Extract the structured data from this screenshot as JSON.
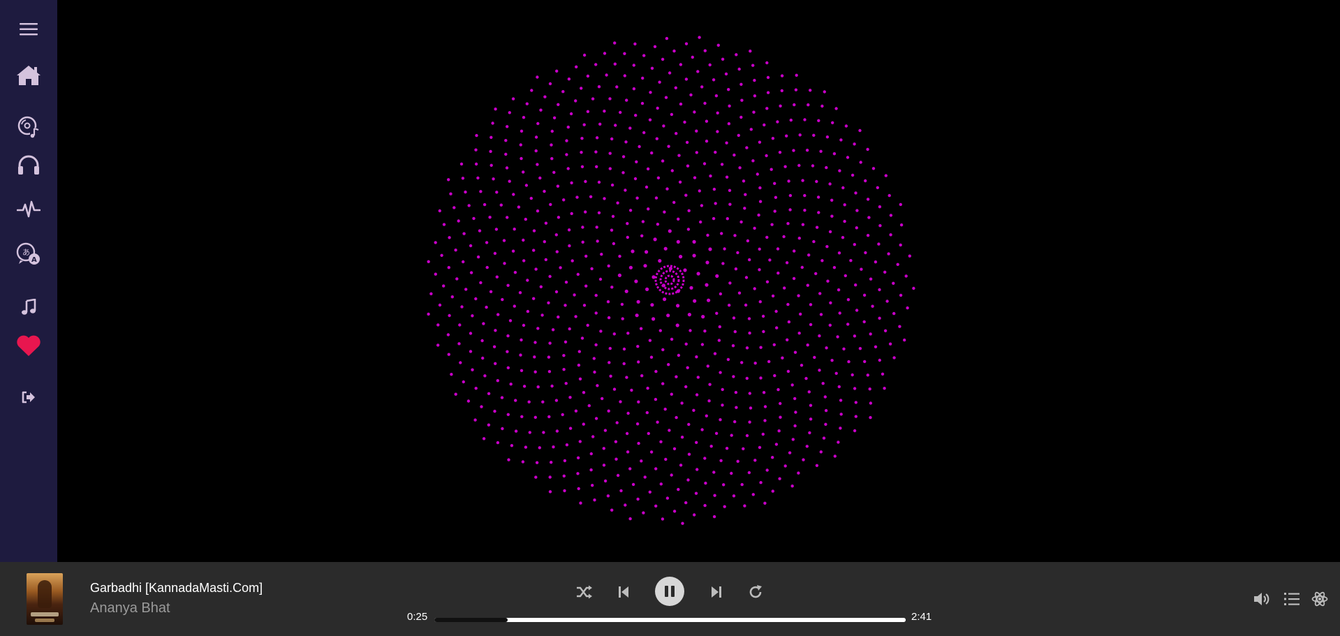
{
  "sidebar": {
    "items": [
      {
        "icon": "hamburger-menu-icon"
      },
      {
        "icon": "home-icon"
      },
      {
        "icon": "disc-music-icon"
      },
      {
        "icon": "headphones-icon"
      },
      {
        "icon": "pulse-icon"
      },
      {
        "icon": "translate-icon"
      },
      {
        "icon": "music-note-icon"
      },
      {
        "icon": "heart-icon"
      },
      {
        "icon": "logout-icon"
      }
    ],
    "colors": {
      "background": "#1e1b3f",
      "icon": "#d4c2dd",
      "heart": "#e8164f"
    }
  },
  "visualizer": {
    "type": "phyllotaxis-spiral",
    "dot_color": "#c800c8"
  },
  "player": {
    "track_title": "Garbadhi [KannadaMasti.Com]",
    "artist": "Ananya Bhat",
    "current_time": "0:25",
    "duration": "2:41",
    "progress_fraction": 0.155,
    "controls": [
      "shuffle-icon",
      "previous-icon",
      "pause-icon",
      "next-icon",
      "repeat-icon"
    ],
    "right_controls": [
      "volume-icon",
      "queue-list-icon",
      "react-icon"
    ]
  }
}
